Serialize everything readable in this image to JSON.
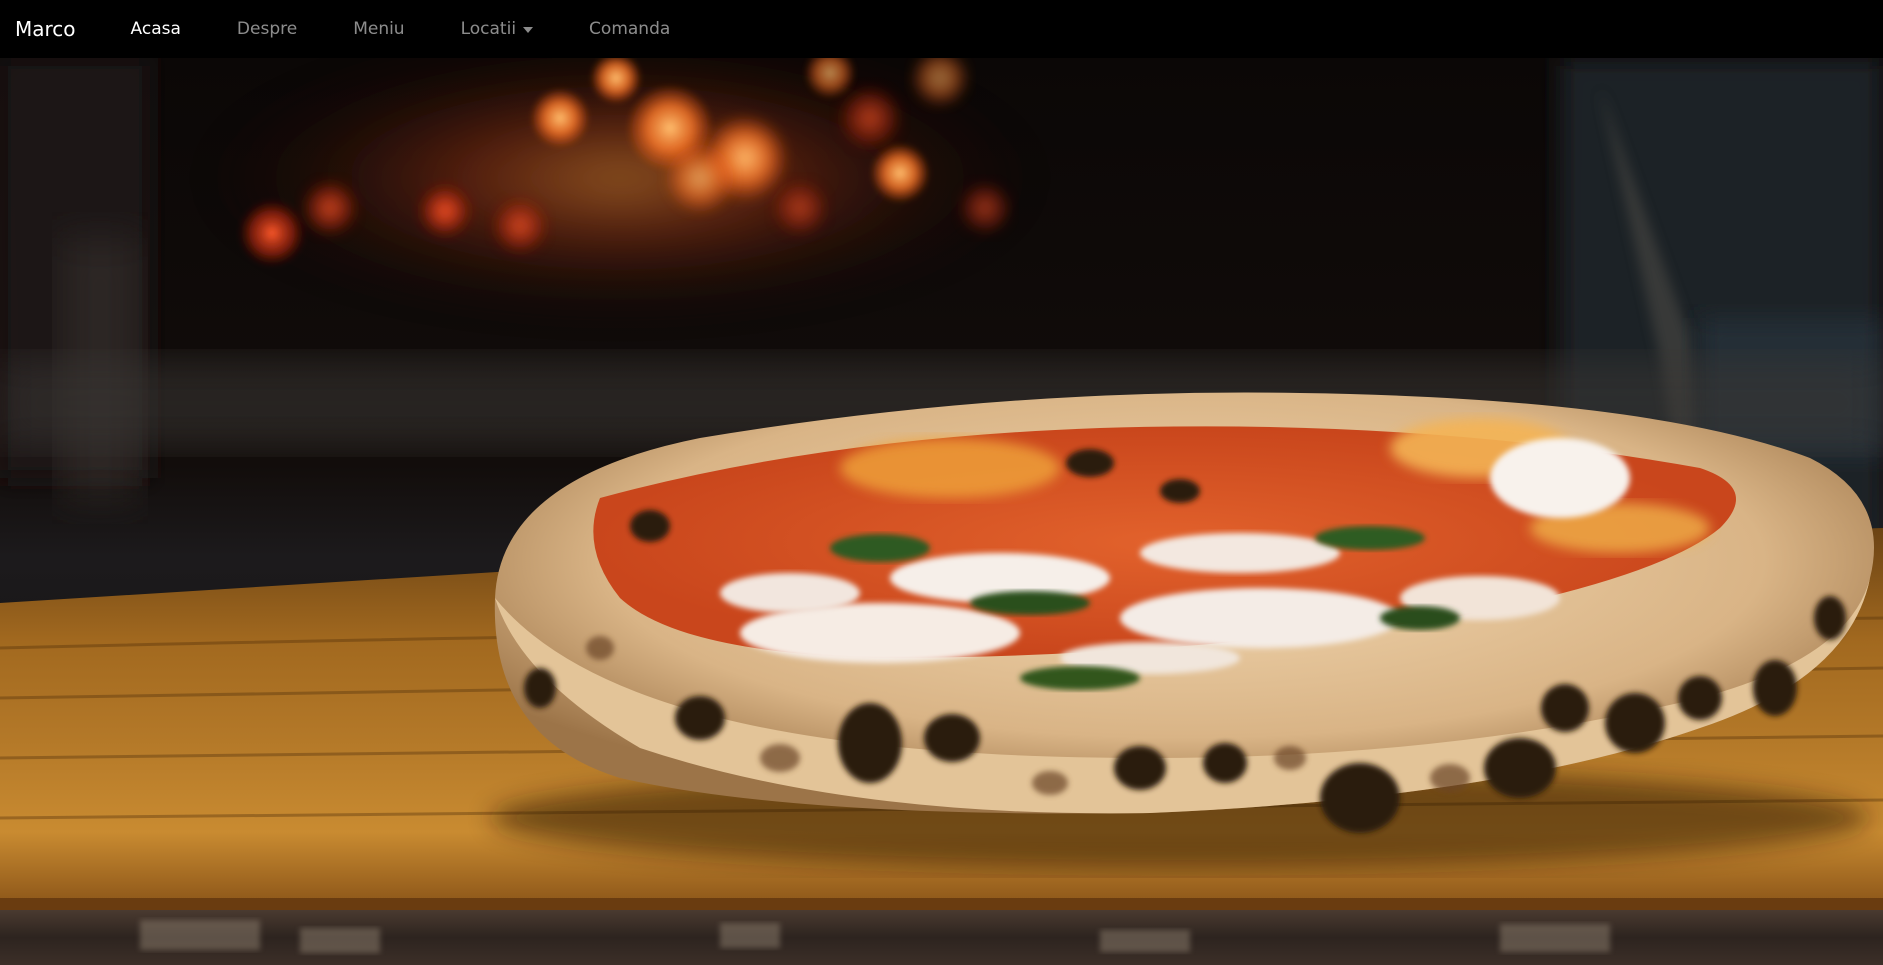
{
  "navbar": {
    "brand": "Marco",
    "items": [
      {
        "label": "Acasa",
        "active": true
      },
      {
        "label": "Despre",
        "active": false
      },
      {
        "label": "Meniu",
        "active": false
      },
      {
        "label": "Locatii",
        "active": false,
        "dropdown": true
      },
      {
        "label": "Comanda",
        "active": false
      }
    ]
  },
  "hero": {
    "image": "pizza-in-front-of-wood-fired-oven"
  },
  "colors": {
    "navbar_bg": "#000000",
    "nav_active": "#ffffff",
    "nav_inactive": "rgba(255,255,255,0.55)"
  }
}
